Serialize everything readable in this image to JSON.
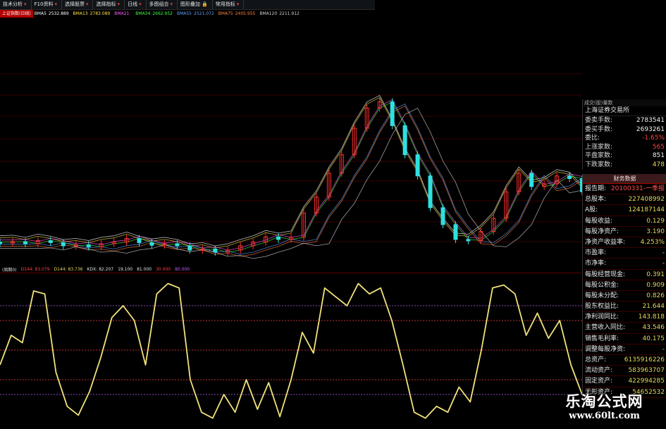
{
  "toolbar": {
    "items": [
      {
        "label": "技术分析",
        "icon": "dropdown-arrow"
      },
      {
        "label": "F10资料",
        "icon": "dropdown-arrow"
      },
      {
        "label": "选择股票",
        "icon": "dropdown-arrow"
      },
      {
        "label": "选择指标",
        "icon": "dropdown-arrow"
      },
      {
        "label": "日线",
        "icon": "dropdown-arrow"
      },
      {
        "label": "多图组合",
        "icon": "dropdown-arrow"
      },
      {
        "label": "图形叠加",
        "icon": "lock-icon"
      },
      {
        "label": "常用指标",
        "icon": "dropdown-arrow"
      }
    ]
  },
  "ma_legend": {
    "title": "上证指数(日线)",
    "items": [
      {
        "tag": "BMA5",
        "value": "2532.889",
        "color": "#ffffff"
      },
      {
        "tag": "BMA13",
        "value": "2783.089",
        "color": "#ffe040"
      },
      {
        "tag": "BMA21",
        "value": "",
        "color": "#ff60ff"
      },
      {
        "tag": "BMA34",
        "value": "2662.952",
        "color": "#40ff40"
      },
      {
        "tag": "BMA55",
        "value": "2521.072",
        "color": "#60a0ff"
      },
      {
        "tag": "BMA75",
        "value": "2405.955",
        "color": "#ff8040"
      },
      {
        "tag": "BMA120",
        "value": "2211.912",
        "color": "#d0d0d0"
      }
    ]
  },
  "indicator_legend": {
    "items": [
      {
        "text": "(周期0)",
        "color": "#e0e0e0"
      },
      {
        "text": "D144: 83.079",
        "color": "#ff4040"
      },
      {
        "text": "D144: 83.736",
        "color": "#e6d85a"
      },
      {
        "text": "KDX: 82.207",
        "color": "#e0e0e0"
      },
      {
        "text": "19.100",
        "color": "#e0e0e0"
      },
      {
        "text": "81.000",
        "color": "#e0e0e0"
      },
      {
        "text": "30.000",
        "color": "#ff4040"
      },
      {
        "text": "80.000",
        "color": "#c060ff"
      }
    ]
  },
  "quote_panel": {
    "header": "成交(股)量数",
    "exchange": "上海证券交易所",
    "rows": [
      {
        "label": "委卖手数:",
        "value": "2783541",
        "color": "#f0f0f0"
      },
      {
        "label": "委买手数:",
        "value": "2693261",
        "color": "#f0f0f0"
      },
      {
        "label": "委比:",
        "value": "-1.65%",
        "color": "#ff4040"
      },
      {
        "label": "上涨家数:",
        "value": "565",
        "color": "#ff4040"
      },
      {
        "label": "平盘家数:",
        "value": "851",
        "color": "#f0f0f0"
      },
      {
        "label": "下跌家数:",
        "value": "478",
        "color": "#e6d85a"
      }
    ]
  },
  "financial_panel": {
    "title": "财务数据",
    "rows": [
      {
        "label": "报告期:",
        "value": "20100331-一季报",
        "red": true
      },
      {
        "label": "总股本:",
        "value": "227408992",
        "red": false
      },
      {
        "label": "A股:",
        "value": "124187144",
        "red": false
      },
      {
        "label": "每股收益:",
        "value": "0.129",
        "red": false
      },
      {
        "label": "每股净资产:",
        "value": "3.190",
        "red": false
      },
      {
        "label": "净资产收益率:",
        "value": "4.253%",
        "red": false
      },
      {
        "label": "市盈率:",
        "value": "-",
        "red": false
      },
      {
        "label": "市净率:",
        "value": "-",
        "red": false
      },
      {
        "label": "每股经营现金:",
        "value": "0.391",
        "red": false
      },
      {
        "label": "每股公积金:",
        "value": "0.909",
        "red": false
      },
      {
        "label": "每股未分配:",
        "value": "0.826",
        "red": false
      },
      {
        "label": "股东权益比:",
        "value": "21.644",
        "red": false
      },
      {
        "label": "净利润同比:",
        "value": "143.818",
        "red": false
      },
      {
        "label": "主营收入同比:",
        "value": "43.546",
        "red": false
      },
      {
        "label": "销售毛利率:",
        "value": "40.175",
        "red": false
      },
      {
        "label": "调整每股净资:",
        "value": "-",
        "red": false
      },
      {
        "label": "总资产:",
        "value": "6135916226",
        "red": false
      },
      {
        "label": "流动资产:",
        "value": "583963707",
        "red": false
      },
      {
        "label": "固定资产:",
        "value": "422994285",
        "red": false
      },
      {
        "label": "无形资产:",
        "value": "54652532",
        "red": false
      }
    ]
  },
  "watermark": {
    "title": "乐淘公式网",
    "url": "www.60lt.com"
  },
  "chart_data": [
    {
      "type": "line",
      "panel": "price",
      "series": [
        {
          "name": "BMA5",
          "values": [
            3050,
            3060,
            3020,
            3080,
            3040,
            2980,
            3000,
            2960,
            3020,
            3050,
            3120,
            3040,
            2990,
            3020,
            2980,
            2900,
            2920,
            2860,
            2900,
            2980,
            3050,
            3150,
            3100,
            3140,
            3600,
            3900,
            4350,
            4700,
            5200,
            5580,
            5700,
            5250,
            4700,
            4300,
            3700,
            3380,
            3100,
            3080,
            3250,
            3500,
            4000,
            4350,
            4100,
            4150,
            4300,
            4250,
            4000
          ]
        }
      ]
    },
    {
      "type": "line",
      "panel": "oscillator",
      "y_range": [
        0,
        100
      ],
      "reference_levels": [
        20,
        30,
        50,
        70,
        80
      ],
      "series": [
        {
          "name": "KDX",
          "values": [
            40,
            60,
            55,
            90,
            88,
            35,
            12,
            6,
            22,
            45,
            72,
            80,
            70,
            40,
            88,
            95,
            92,
            30,
            8,
            4,
            20,
            8,
            30,
            10,
            28,
            5,
            30,
            62,
            48,
            92,
            86,
            80,
            95,
            88,
            92,
            70,
            40,
            8,
            4,
            12,
            8,
            25,
            15,
            50,
            92,
            94,
            88,
            60,
            75,
            58,
            70,
            40,
            20
          ]
        }
      ]
    }
  ]
}
